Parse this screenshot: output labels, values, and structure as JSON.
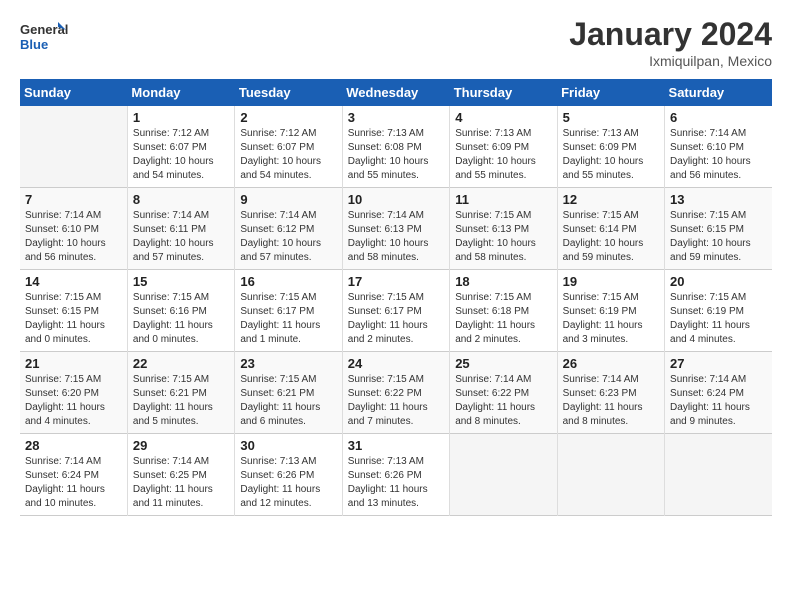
{
  "header": {
    "logo_general": "General",
    "logo_blue": "Blue",
    "month_title": "January 2024",
    "location": "Ixmiquilpan, Mexico"
  },
  "days_of_week": [
    "Sunday",
    "Monday",
    "Tuesday",
    "Wednesday",
    "Thursday",
    "Friday",
    "Saturday"
  ],
  "weeks": [
    [
      {
        "day": "",
        "info": ""
      },
      {
        "day": "1",
        "info": "Sunrise: 7:12 AM\nSunset: 6:07 PM\nDaylight: 10 hours\nand 54 minutes."
      },
      {
        "day": "2",
        "info": "Sunrise: 7:12 AM\nSunset: 6:07 PM\nDaylight: 10 hours\nand 54 minutes."
      },
      {
        "day": "3",
        "info": "Sunrise: 7:13 AM\nSunset: 6:08 PM\nDaylight: 10 hours\nand 55 minutes."
      },
      {
        "day": "4",
        "info": "Sunrise: 7:13 AM\nSunset: 6:09 PM\nDaylight: 10 hours\nand 55 minutes."
      },
      {
        "day": "5",
        "info": "Sunrise: 7:13 AM\nSunset: 6:09 PM\nDaylight: 10 hours\nand 55 minutes."
      },
      {
        "day": "6",
        "info": "Sunrise: 7:14 AM\nSunset: 6:10 PM\nDaylight: 10 hours\nand 56 minutes."
      }
    ],
    [
      {
        "day": "7",
        "info": "Sunrise: 7:14 AM\nSunset: 6:10 PM\nDaylight: 10 hours\nand 56 minutes."
      },
      {
        "day": "8",
        "info": "Sunrise: 7:14 AM\nSunset: 6:11 PM\nDaylight: 10 hours\nand 57 minutes."
      },
      {
        "day": "9",
        "info": "Sunrise: 7:14 AM\nSunset: 6:12 PM\nDaylight: 10 hours\nand 57 minutes."
      },
      {
        "day": "10",
        "info": "Sunrise: 7:14 AM\nSunset: 6:13 PM\nDaylight: 10 hours\nand 58 minutes."
      },
      {
        "day": "11",
        "info": "Sunrise: 7:15 AM\nSunset: 6:13 PM\nDaylight: 10 hours\nand 58 minutes."
      },
      {
        "day": "12",
        "info": "Sunrise: 7:15 AM\nSunset: 6:14 PM\nDaylight: 10 hours\nand 59 minutes."
      },
      {
        "day": "13",
        "info": "Sunrise: 7:15 AM\nSunset: 6:15 PM\nDaylight: 10 hours\nand 59 minutes."
      }
    ],
    [
      {
        "day": "14",
        "info": "Sunrise: 7:15 AM\nSunset: 6:15 PM\nDaylight: 11 hours\nand 0 minutes."
      },
      {
        "day": "15",
        "info": "Sunrise: 7:15 AM\nSunset: 6:16 PM\nDaylight: 11 hours\nand 0 minutes."
      },
      {
        "day": "16",
        "info": "Sunrise: 7:15 AM\nSunset: 6:17 PM\nDaylight: 11 hours\nand 1 minute."
      },
      {
        "day": "17",
        "info": "Sunrise: 7:15 AM\nSunset: 6:17 PM\nDaylight: 11 hours\nand 2 minutes."
      },
      {
        "day": "18",
        "info": "Sunrise: 7:15 AM\nSunset: 6:18 PM\nDaylight: 11 hours\nand 2 minutes."
      },
      {
        "day": "19",
        "info": "Sunrise: 7:15 AM\nSunset: 6:19 PM\nDaylight: 11 hours\nand 3 minutes."
      },
      {
        "day": "20",
        "info": "Sunrise: 7:15 AM\nSunset: 6:19 PM\nDaylight: 11 hours\nand 4 minutes."
      }
    ],
    [
      {
        "day": "21",
        "info": "Sunrise: 7:15 AM\nSunset: 6:20 PM\nDaylight: 11 hours\nand 4 minutes."
      },
      {
        "day": "22",
        "info": "Sunrise: 7:15 AM\nSunset: 6:21 PM\nDaylight: 11 hours\nand 5 minutes."
      },
      {
        "day": "23",
        "info": "Sunrise: 7:15 AM\nSunset: 6:21 PM\nDaylight: 11 hours\nand 6 minutes."
      },
      {
        "day": "24",
        "info": "Sunrise: 7:15 AM\nSunset: 6:22 PM\nDaylight: 11 hours\nand 7 minutes."
      },
      {
        "day": "25",
        "info": "Sunrise: 7:14 AM\nSunset: 6:22 PM\nDaylight: 11 hours\nand 8 minutes."
      },
      {
        "day": "26",
        "info": "Sunrise: 7:14 AM\nSunset: 6:23 PM\nDaylight: 11 hours\nand 8 minutes."
      },
      {
        "day": "27",
        "info": "Sunrise: 7:14 AM\nSunset: 6:24 PM\nDaylight: 11 hours\nand 9 minutes."
      }
    ],
    [
      {
        "day": "28",
        "info": "Sunrise: 7:14 AM\nSunset: 6:24 PM\nDaylight: 11 hours\nand 10 minutes."
      },
      {
        "day": "29",
        "info": "Sunrise: 7:14 AM\nSunset: 6:25 PM\nDaylight: 11 hours\nand 11 minutes."
      },
      {
        "day": "30",
        "info": "Sunrise: 7:13 AM\nSunset: 6:26 PM\nDaylight: 11 hours\nand 12 minutes."
      },
      {
        "day": "31",
        "info": "Sunrise: 7:13 AM\nSunset: 6:26 PM\nDaylight: 11 hours\nand 13 minutes."
      },
      {
        "day": "",
        "info": ""
      },
      {
        "day": "",
        "info": ""
      },
      {
        "day": "",
        "info": ""
      }
    ]
  ]
}
